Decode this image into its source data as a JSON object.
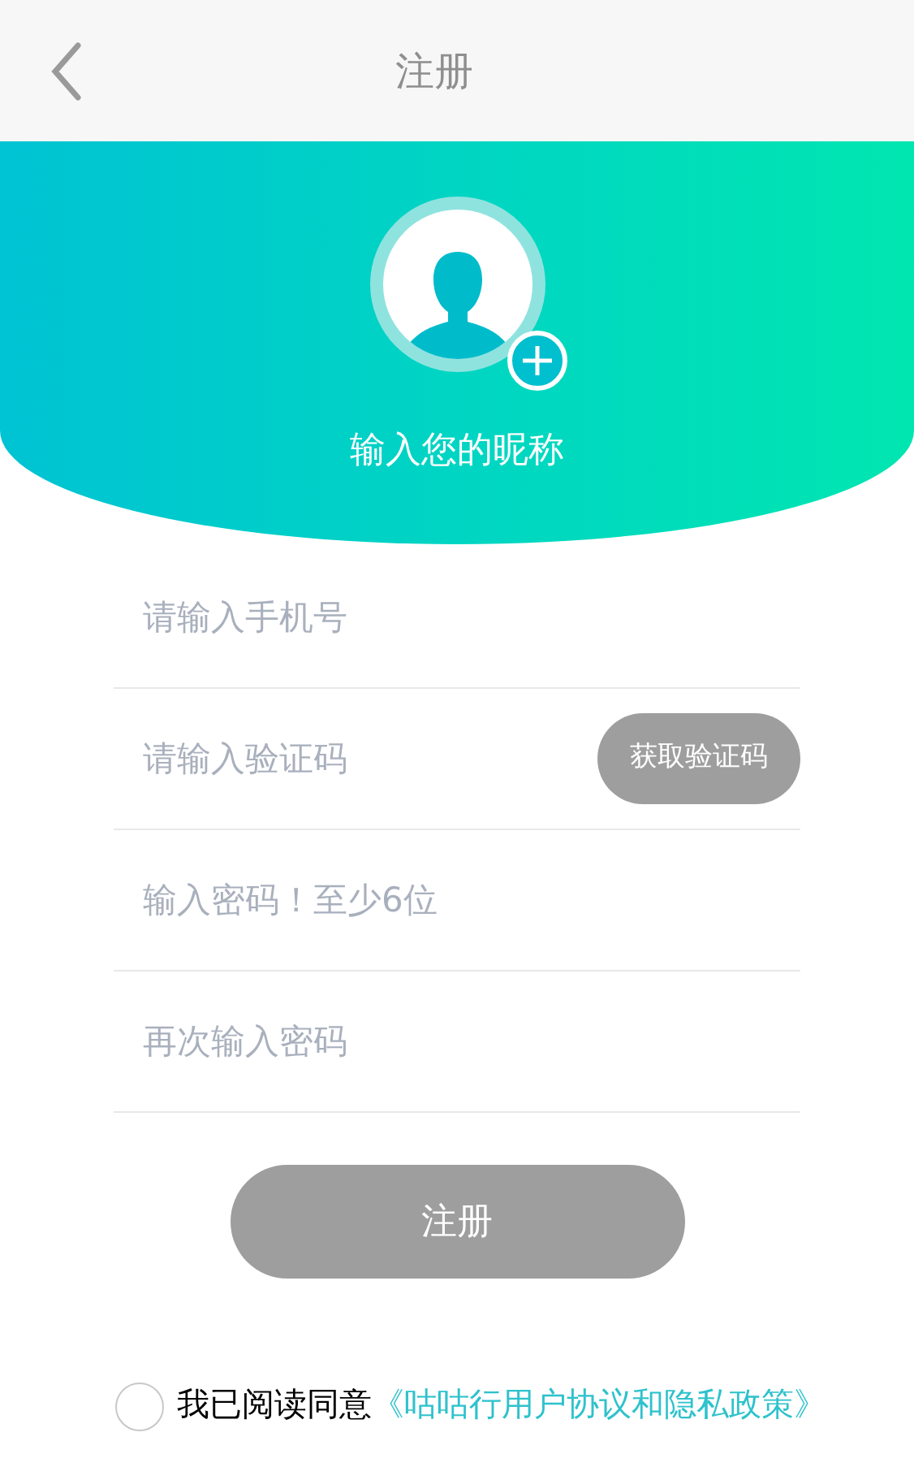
{
  "header": {
    "title": "注册"
  },
  "profile": {
    "nickname_placeholder": "输入您的昵称"
  },
  "fields": [
    {
      "placeholder": "请输入手机号"
    },
    {
      "placeholder": "请输入验证码",
      "button": "获取验证码"
    },
    {
      "placeholder": "输入密码！至少6位"
    },
    {
      "placeholder": "再次输入密码"
    }
  ],
  "submit": {
    "label": "注册",
    "disabled": true
  },
  "agreement": {
    "checked": false,
    "text": "我已阅读同意",
    "link": "《咕咕行用户协议和隐私政策》"
  }
}
